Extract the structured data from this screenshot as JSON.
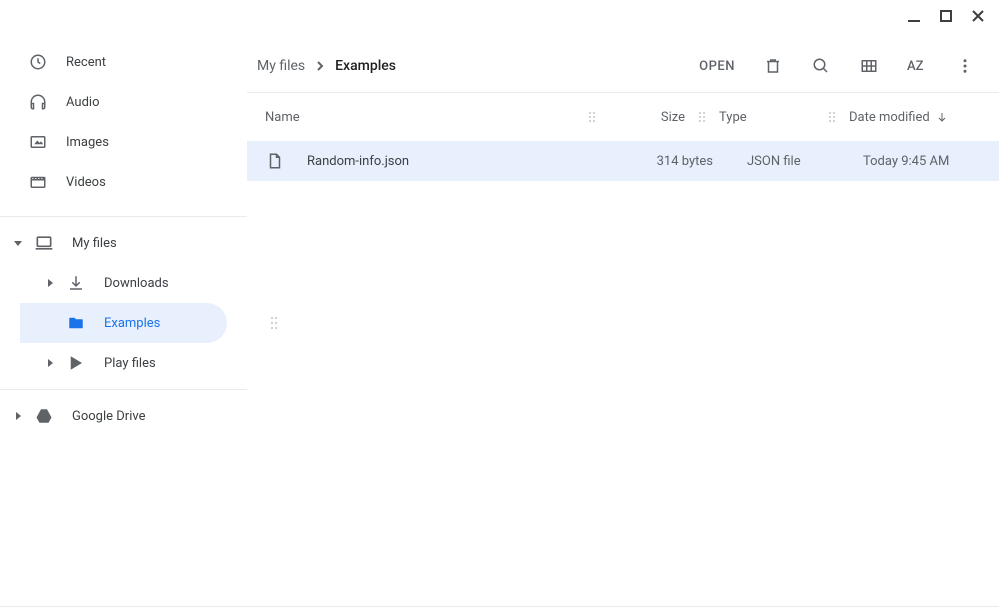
{
  "window": {
    "minimize": "Minimize",
    "maximize": "Maximize",
    "close": "Close"
  },
  "sidebar": {
    "quick": [
      {
        "icon": "clock",
        "label": "Recent"
      },
      {
        "icon": "headphones",
        "label": "Audio"
      },
      {
        "icon": "image",
        "label": "Images"
      },
      {
        "icon": "video",
        "label": "Videos"
      }
    ],
    "tree": {
      "myfiles": {
        "label": "My files",
        "children": [
          {
            "icon": "download",
            "label": "Downloads"
          },
          {
            "icon": "folder",
            "label": "Examples",
            "active": true
          },
          {
            "icon": "play",
            "label": "Play files"
          }
        ]
      },
      "gdrive": {
        "label": "Google Drive"
      }
    }
  },
  "breadcrumb": {
    "root": "My files",
    "current": "Examples"
  },
  "toolbar": {
    "open_label": "OPEN"
  },
  "columns": {
    "name": "Name",
    "size": "Size",
    "type": "Type",
    "date": "Date modified"
  },
  "rows": [
    {
      "name": "Random-info.json",
      "size": "314 bytes",
      "type": "JSON file",
      "date": "Today 9:45 AM",
      "selected": true
    }
  ]
}
